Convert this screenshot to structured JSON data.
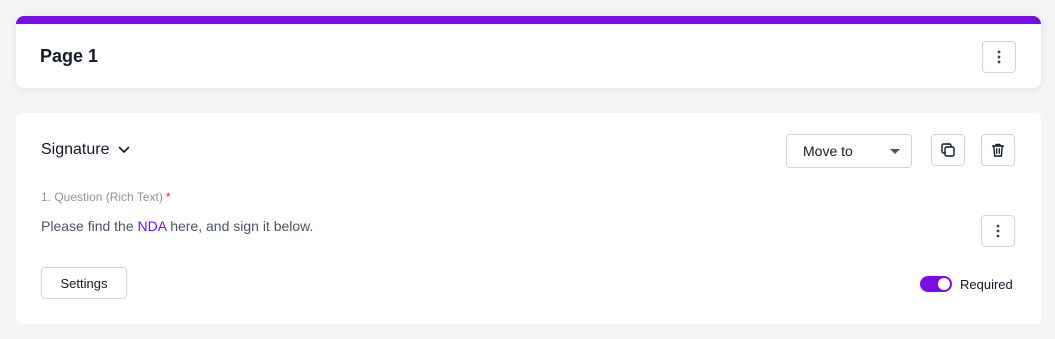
{
  "page": {
    "title": "Page 1",
    "accent_color": "#7c0ce6",
    "menu_icon": "vertical-dots-icon"
  },
  "question": {
    "type_label": "Signature",
    "type_icon": "chevron-down-icon",
    "move_to_label": "Move to",
    "copy_icon": "copy-icon",
    "delete_icon": "trash-icon",
    "label": "1. Question (Rich Text)",
    "required_marker": "*",
    "text_before": "Please find the ",
    "text_link": "NDA",
    "text_after": " here, and sign it below.",
    "menu_icon": "vertical-dots-icon",
    "settings_label": "Settings",
    "required_label": "Required",
    "required_on": true
  }
}
